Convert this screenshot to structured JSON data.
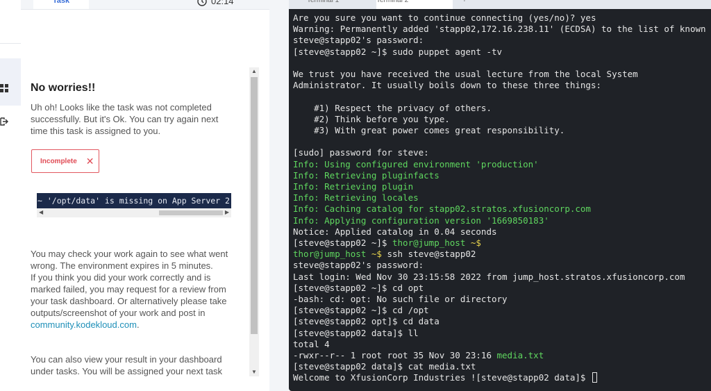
{
  "header": {
    "task_tab": "Task",
    "timer": "02:14",
    "terminal_tabs": [
      "Terminal 1",
      "Terminal 2",
      "+"
    ]
  },
  "result": {
    "title": "No worries!!",
    "message": "Uh oh! Looks like the task was not completed successfully. But it's Ok. You can try again next time this task is assigned to you.",
    "badge_label": "Incomplete",
    "error_code": "~ '/opt/data' is missing on App Server 2",
    "recheck_text": "You may check your work again to see what went wrong. The environment expires in 5 minutes.",
    "review_text": "If you think you did your work correctly and is marked failed, you may request for a review from your task dashboard. Or alternatively please take outputs/screenshot of your work and post in",
    "community_link": "community.kodekloud.com",
    "link_suffix": ".",
    "dashboard_text": "You can also view your result in your dashboard under tasks. You will be assigned your next task"
  },
  "terminal": {
    "lines": [
      [
        {
          "t": "Are you sure you want to continue connecting (yes/no)? yes",
          "c": ""
        }
      ],
      [
        {
          "t": "Warning: Permanently added 'stapp02,172.16.238.11' (ECDSA) to the list of known h",
          "c": ""
        }
      ],
      [
        {
          "t": "steve@stapp02's password:",
          "c": ""
        }
      ],
      [
        {
          "t": "[steve@stapp02 ~]$ sudo puppet agent -tv",
          "c": ""
        }
      ],
      [
        {
          "t": "",
          "c": ""
        }
      ],
      [
        {
          "t": "We trust you have received the usual lecture from the local System",
          "c": ""
        }
      ],
      [
        {
          "t": "Administrator. It usually boils down to these three things:",
          "c": ""
        }
      ],
      [
        {
          "t": "",
          "c": ""
        }
      ],
      [
        {
          "t": "    #1) Respect the privacy of others.",
          "c": ""
        }
      ],
      [
        {
          "t": "    #2) Think before you type.",
          "c": ""
        }
      ],
      [
        {
          "t": "    #3) With great power comes great responsibility.",
          "c": ""
        }
      ],
      [
        {
          "t": "",
          "c": ""
        }
      ],
      [
        {
          "t": "[sudo] password for steve:",
          "c": ""
        }
      ],
      [
        {
          "t": "Info: Using configured environment 'production'",
          "c": "g"
        }
      ],
      [
        {
          "t": "Info: Retrieving pluginfacts",
          "c": "g"
        }
      ],
      [
        {
          "t": "Info: Retrieving plugin",
          "c": "g"
        }
      ],
      [
        {
          "t": "Info: Retrieving locales",
          "c": "g"
        }
      ],
      [
        {
          "t": "Info: Caching catalog for stapp02.stratos.xfusioncorp.com",
          "c": "g"
        }
      ],
      [
        {
          "t": "Info: Applying configuration version '1669850183'",
          "c": "g"
        }
      ],
      [
        {
          "t": "Notice: Applied catalog in 0.04 seconds",
          "c": ""
        }
      ],
      [
        {
          "t": "[steve@stapp02 ~]$ ",
          "c": ""
        },
        {
          "t": "thor@jump_host",
          "c": "g"
        },
        {
          "t": " ~$",
          "c": "y"
        }
      ],
      [
        {
          "t": "thor@jump_host",
          "c": "g"
        },
        {
          "t": " ~$",
          "c": "y"
        },
        {
          "t": " ssh steve@stapp02",
          "c": ""
        }
      ],
      [
        {
          "t": "steve@stapp02's password:",
          "c": ""
        }
      ],
      [
        {
          "t": "Last login: Wed Nov 30 23:15:58 2022 from jump_host.stratos.xfusioncorp.com",
          "c": ""
        }
      ],
      [
        {
          "t": "[steve@stapp02 ~]$ cd opt",
          "c": ""
        }
      ],
      [
        {
          "t": "-bash: cd: opt: No such file or directory",
          "c": ""
        }
      ],
      [
        {
          "t": "[steve@stapp02 ~]$ cd /opt",
          "c": ""
        }
      ],
      [
        {
          "t": "[steve@stapp02 opt]$ cd data",
          "c": ""
        }
      ],
      [
        {
          "t": "[steve@stapp02 data]$ ll",
          "c": ""
        }
      ],
      [
        {
          "t": "total 4",
          "c": ""
        }
      ],
      [
        {
          "t": "-rwxr--r-- 1 root root 35 Nov 30 23:16 ",
          "c": ""
        },
        {
          "t": "media.txt",
          "c": "g"
        }
      ],
      [
        {
          "t": "[steve@stapp02 data]$ cat media.txt",
          "c": ""
        }
      ],
      [
        {
          "t": "Welcome to XfusionCorp Industries ![steve@stapp02 data]$ ",
          "c": ""
        }
      ]
    ]
  },
  "icons": {
    "timer": "clock-icon",
    "rail": [
      "grid-icon",
      "logout-icon"
    ],
    "badge_close": "close-icon"
  }
}
